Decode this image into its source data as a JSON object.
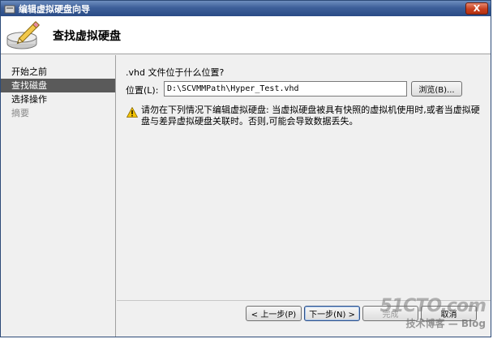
{
  "window": {
    "title": "编辑虚拟硬盘向导",
    "close_glyph": "X"
  },
  "header": {
    "title": "查找虚拟硬盘"
  },
  "sidebar": {
    "items": [
      {
        "label": "开始之前",
        "state": "normal"
      },
      {
        "label": "查找磁盘",
        "state": "active"
      },
      {
        "label": "选择操作",
        "state": "normal"
      },
      {
        "label": "摘要",
        "state": "disabled"
      }
    ]
  },
  "main": {
    "question": ".vhd 文件位于什么位置?",
    "location_label": "位置(L):",
    "location_value": "D:\\SCVMMPath\\Hyper_Test.vhd",
    "browse_label": "浏览(B)...",
    "warning_text": "请勿在下列情况下编辑虚拟硬盘: 当虚拟硬盘被具有快照的虚拟机使用时,或者当虚拟硬盘与差异虚拟硬盘关联时。否则,可能会导致数据丢失。"
  },
  "footer": {
    "prev_label": "< 上一步(P)",
    "next_label": "下一步(N) >",
    "finish_label": "完成",
    "cancel_label": "取消"
  },
  "watermark": {
    "top": "51CTO.com",
    "bottom": "技术博客 — Blog"
  },
  "colors": {
    "title_bar": "#2a4b86",
    "active_item": "#5a5a5a",
    "close_button": "#c8401f",
    "warning": "#f5c400"
  }
}
